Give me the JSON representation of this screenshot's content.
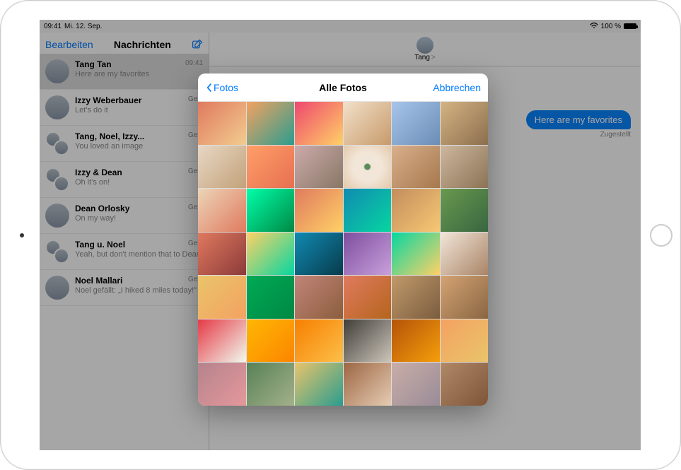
{
  "status_bar": {
    "time": "09:41",
    "date": "Mi. 12. Sep.",
    "battery_pct": "100 %",
    "wifi_glyph": "▾"
  },
  "sidebar": {
    "edit_label": "Bearbeiten",
    "title": "Nachrichten",
    "conversations": [
      {
        "name": "Tang Tan",
        "time": "09:41",
        "preview": "Here are my favorites",
        "selected": true,
        "group": false
      },
      {
        "name": "Izzy Weberbauer",
        "time": "Gest",
        "preview": "Let's do it",
        "selected": false,
        "group": false
      },
      {
        "name": "Tang, Noel, Izzy...",
        "time": "Gest",
        "preview": "You loved an image",
        "selected": false,
        "group": true
      },
      {
        "name": "Izzy & Dean",
        "time": "Gest",
        "preview": "Oh it's on!",
        "selected": false,
        "group": true
      },
      {
        "name": "Dean Orlosky",
        "time": "Gest",
        "preview": "On my way!",
        "selected": false,
        "group": false
      },
      {
        "name": "Tang u. Noel",
        "time": "Gest",
        "preview": "Yeah, but don't mention that to Dean",
        "selected": false,
        "group": true
      },
      {
        "name": "Noel Mallari",
        "time": "Gest",
        "preview": "Noel gefällt: „I hiked 8 miles today!\"",
        "selected": false,
        "group": false
      }
    ]
  },
  "main": {
    "contact_name": "Tang",
    "chevron": ">",
    "bubble_text": "Here are my favorites",
    "delivered_label": "Zugestellt"
  },
  "popover": {
    "back_label": "Fotos",
    "title": "Alle Fotos",
    "cancel_label": "Abbrechen",
    "photo_count": 42
  }
}
